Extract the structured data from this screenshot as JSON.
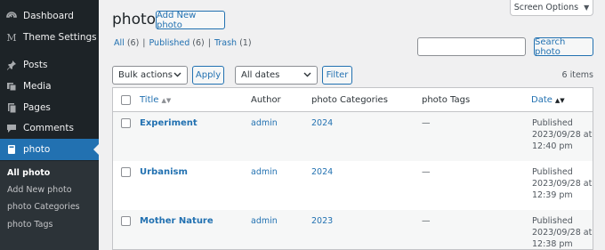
{
  "sidebar": {
    "items": [
      {
        "label": "Dashboard",
        "icon": "dashboard-icon"
      },
      {
        "label": "Theme Settings",
        "icon": "theme-settings-icon"
      },
      {
        "label": "Posts",
        "icon": "pin-icon"
      },
      {
        "label": "Media",
        "icon": "media-icon"
      },
      {
        "label": "Pages",
        "icon": "pages-icon"
      },
      {
        "label": "Comments",
        "icon": "comments-icon"
      },
      {
        "label": "photo",
        "icon": "photo-icon"
      }
    ],
    "submenu": [
      "All photo",
      "Add New photo",
      "photo Categories",
      "photo Tags"
    ]
  },
  "header": {
    "title": "photo",
    "add_new_label": "Add New photo",
    "screen_options_label": "Screen Options"
  },
  "views": [
    {
      "label": "All",
      "count": "(6)"
    },
    {
      "label": "Published",
      "count": "(6)"
    },
    {
      "label": "Trash",
      "count": "(1)"
    }
  ],
  "search": {
    "button_label": "Search photo",
    "value": ""
  },
  "filters": {
    "bulk_actions": "Bulk actions",
    "apply_label": "Apply",
    "dates": "All dates",
    "filter_label": "Filter",
    "items_count": "6 items"
  },
  "table": {
    "columns": [
      "Title",
      "Author",
      "photo Categories",
      "photo Tags",
      "Date"
    ],
    "rows": [
      {
        "title": "Experiment",
        "author": "admin",
        "category": "2024",
        "tags": "—",
        "status": "Published",
        "date": "2023/09/28 at",
        "time": "12:40 pm"
      },
      {
        "title": "Urbanism",
        "author": "admin",
        "category": "2024",
        "tags": "—",
        "status": "Published",
        "date": "2023/09/28 at",
        "time": "12:39 pm"
      },
      {
        "title": "Mother Nature",
        "author": "admin",
        "category": "2023",
        "tags": "—",
        "status": "Published",
        "date": "2023/09/28 at",
        "time": "12:38 pm"
      }
    ]
  },
  "colors": {
    "accent": "#2271b1",
    "sidebar_bg": "#1d2327",
    "submenu_bg": "#2c3338",
    "page_bg": "#f0f0f1"
  }
}
